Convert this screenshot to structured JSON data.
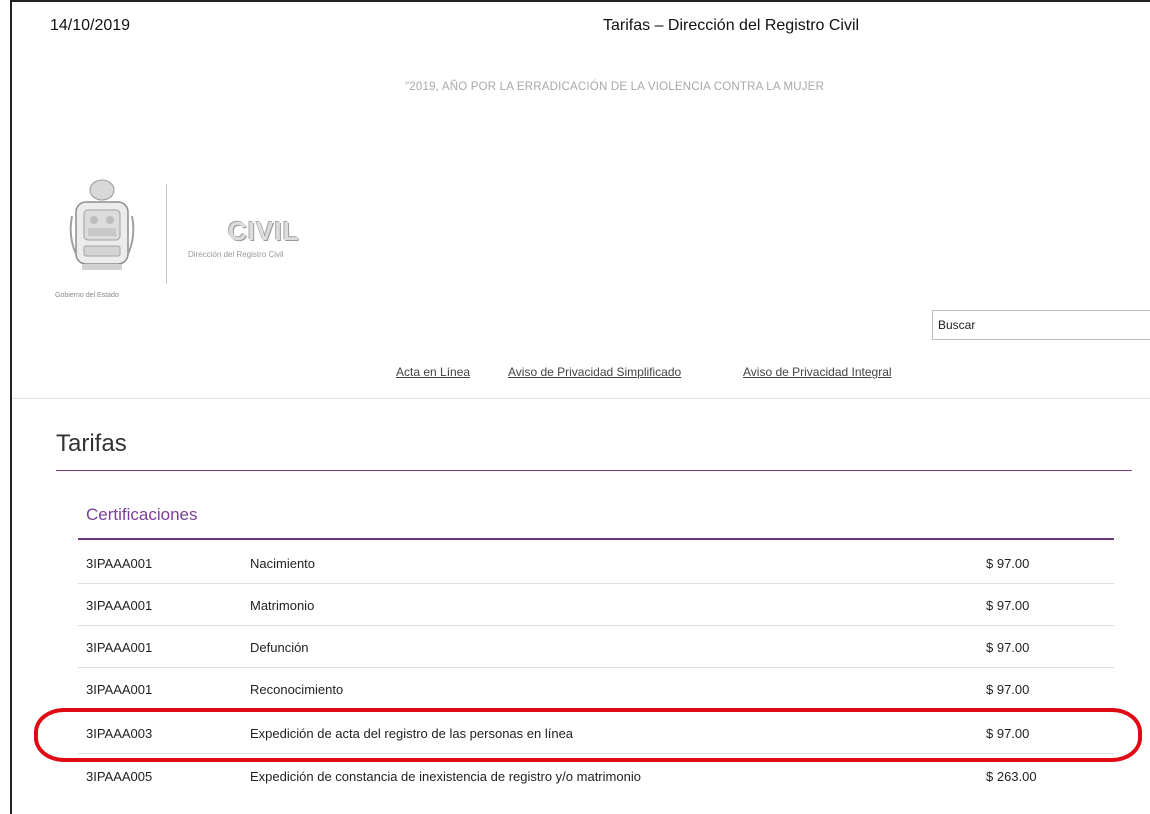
{
  "print_header": {
    "date": "14/10/2019",
    "title": "Tarifas – Dirección del Registro Civil"
  },
  "slogan": "\"2019, AÑO POR LA ERRADICACIÓN DE LA VIOLENCIA CONTRA LA MUJER",
  "logo": {
    "civil": "CIVIL",
    "subtitle": "Dirección del Registro Civil",
    "caption": "Gobierno del Estado"
  },
  "search": {
    "value": "Buscar"
  },
  "nav": {
    "items": [
      {
        "label": "Acta en Línea"
      },
      {
        "label": "Aviso de Privacidad Simplificado"
      },
      {
        "label": "Aviso de Privacidad Integral"
      }
    ]
  },
  "page": {
    "title": "Tarifas"
  },
  "section": {
    "title": "Certificaciones",
    "rows": [
      {
        "code": "3IPAAA001",
        "description": "Nacimiento",
        "price": "$ 97.00"
      },
      {
        "code": "3IPAAA001",
        "description": "Matrimonio",
        "price": "$ 97.00"
      },
      {
        "code": "3IPAAA001",
        "description": "Defunción",
        "price": "$ 97.00"
      },
      {
        "code": "3IPAAA001",
        "description": "Reconocimiento",
        "price": "$ 97.00"
      },
      {
        "code": "3IPAAA003",
        "description": "Expedición de acta del registro de las personas en línea",
        "price": "$ 97.00"
      },
      {
        "code": "3IPAAA005",
        "description": "Expedición de constancia de inexistencia de registro y/o matrimonio",
        "price": "$ 263.00"
      }
    ]
  },
  "colors": {
    "accent_purple": "#7b3f98",
    "highlight_red": "#e00a14"
  }
}
